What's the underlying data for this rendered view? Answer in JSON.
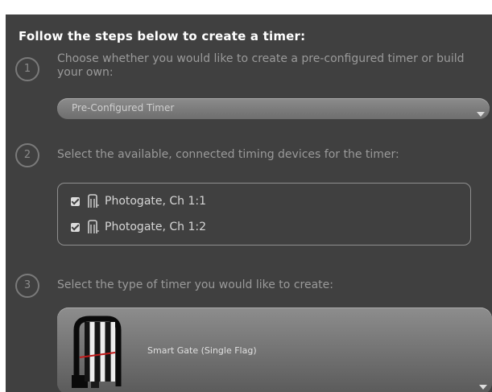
{
  "header": {
    "title": "Follow the steps below to create a timer:"
  },
  "steps": [
    {
      "number": "1",
      "text": "Choose whether you would like to create a pre-configured timer or build your own:"
    },
    {
      "number": "2",
      "text": "Select the available, connected timing devices for the timer:"
    },
    {
      "number": "3",
      "text": "Select the type of timer you would like to create:"
    }
  ],
  "timer_mode": {
    "selected": "Pre-Configured Timer"
  },
  "devices": [
    {
      "label": "Photogate, Ch 1:1",
      "checked": true,
      "icon": "photogate-icon"
    },
    {
      "label": "Photogate, Ch 1:2",
      "checked": true,
      "icon": "photogate-icon"
    }
  ],
  "timer_type": {
    "selected": "Smart Gate (Single Flag)",
    "icon": "smart-gate-icon"
  }
}
